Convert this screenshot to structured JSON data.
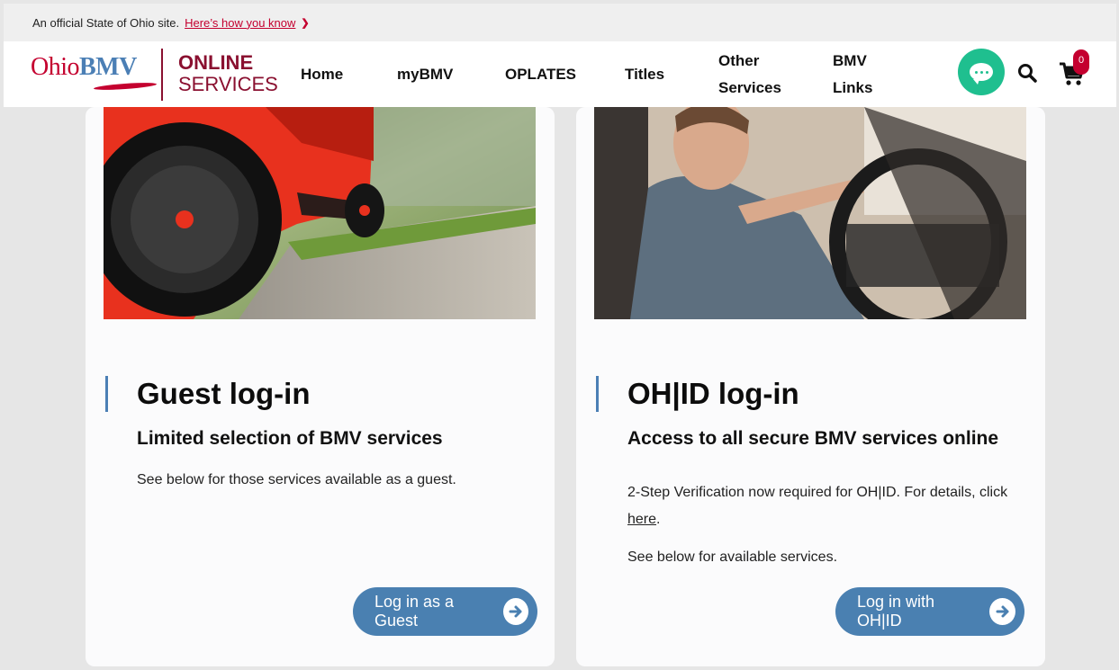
{
  "banner": {
    "text": "An official State of Ohio site.",
    "link": "Here’s how you know"
  },
  "header": {
    "logo_ohio": "Ohio",
    "logo_bmv": "BMV",
    "online_line1": "ONLINE",
    "online_line2": "SERVICES",
    "nav": {
      "home": "Home",
      "mybmv": "myBMV",
      "oplates": "OPLATES",
      "titles": "Titles",
      "other_l1": "Other",
      "other_l2": "Services",
      "links_l1": "BMV",
      "links_l2": "Links"
    },
    "cart_count": "0"
  },
  "guest": {
    "title": "Guest log-in",
    "subtitle": "Limited selection of BMV services",
    "desc": "See below for those services available as a guest.",
    "button": "Log in as a Guest"
  },
  "ohid": {
    "title": "OH|ID log-in",
    "subtitle": "Access to all secure BMV services online",
    "desc_prefix": "2-Step Verification now required for OH|ID. For details, click ",
    "desc_link": "here",
    "desc_suffix": ".",
    "desc2": "See below for available services.",
    "button": "Log in with OH|ID"
  },
  "colors": {
    "accent_blue": "#4a80b1",
    "brand_red": "#c4002f",
    "chat_green": "#1fbf8f"
  }
}
